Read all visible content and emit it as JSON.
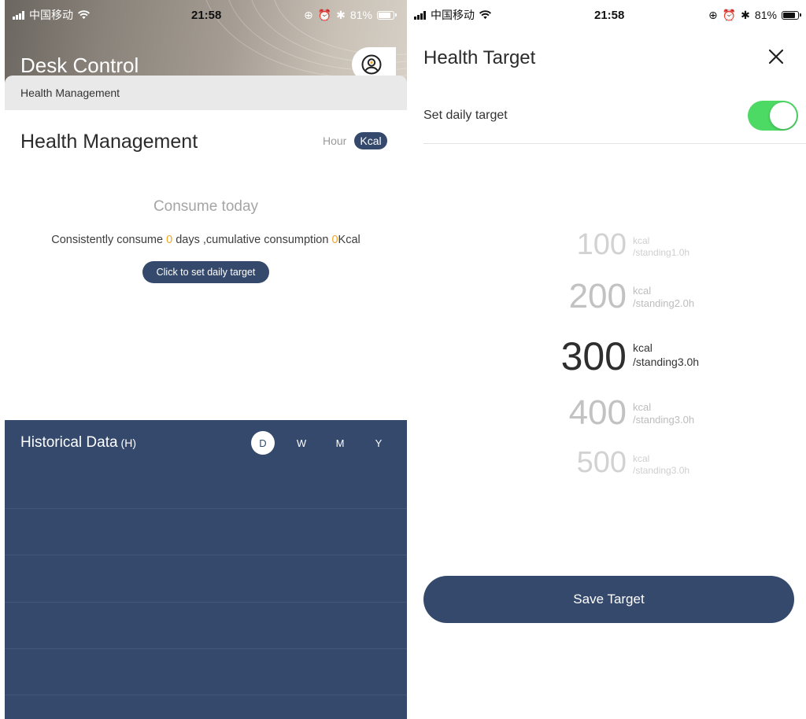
{
  "left_screen": {
    "status_bar": {
      "carrier": "中国移动",
      "time": "21:58",
      "battery": "81%"
    },
    "header": {
      "app_title": "Desk Control",
      "tab_label": "Health Management"
    },
    "health": {
      "title": "Health Management",
      "unit_hour": "Hour",
      "unit_kcal": "Kcal",
      "consume_today": "Consume today",
      "consume_prefix": "Consistently consume ",
      "consume_days": "0",
      "consume_mid": " days ,cumulative consumption ",
      "consume_total": "0",
      "consume_suffix": "Kcal",
      "set_target_button": "Click to set daily target"
    },
    "history": {
      "title": "Historical Data",
      "unit": "(H)",
      "periods": [
        "D",
        "W",
        "M",
        "Y"
      ],
      "active_period": "D"
    }
  },
  "right_screen": {
    "status_bar": {
      "carrier": "中国移动",
      "time": "21:58",
      "battery": "81%"
    },
    "title": "Health Target",
    "set_daily_label": "Set daily target",
    "toggle_on": true,
    "picker": [
      {
        "value": "100",
        "unit": "kcal",
        "sub": "/standing1.0h"
      },
      {
        "value": "200",
        "unit": "kcal",
        "sub": "/standing2.0h"
      },
      {
        "value": "300",
        "unit": "kcal",
        "sub": "/standing3.0h"
      },
      {
        "value": "400",
        "unit": "kcal",
        "sub": "/standing3.0h"
      },
      {
        "value": "500",
        "unit": "kcal",
        "sub": "/standing3.0h"
      }
    ],
    "selected_value": "300",
    "save_button": "Save Target"
  },
  "colors": {
    "navy": "#34496b",
    "orange": "#f5a623",
    "toggle_green": "#4cd964"
  }
}
